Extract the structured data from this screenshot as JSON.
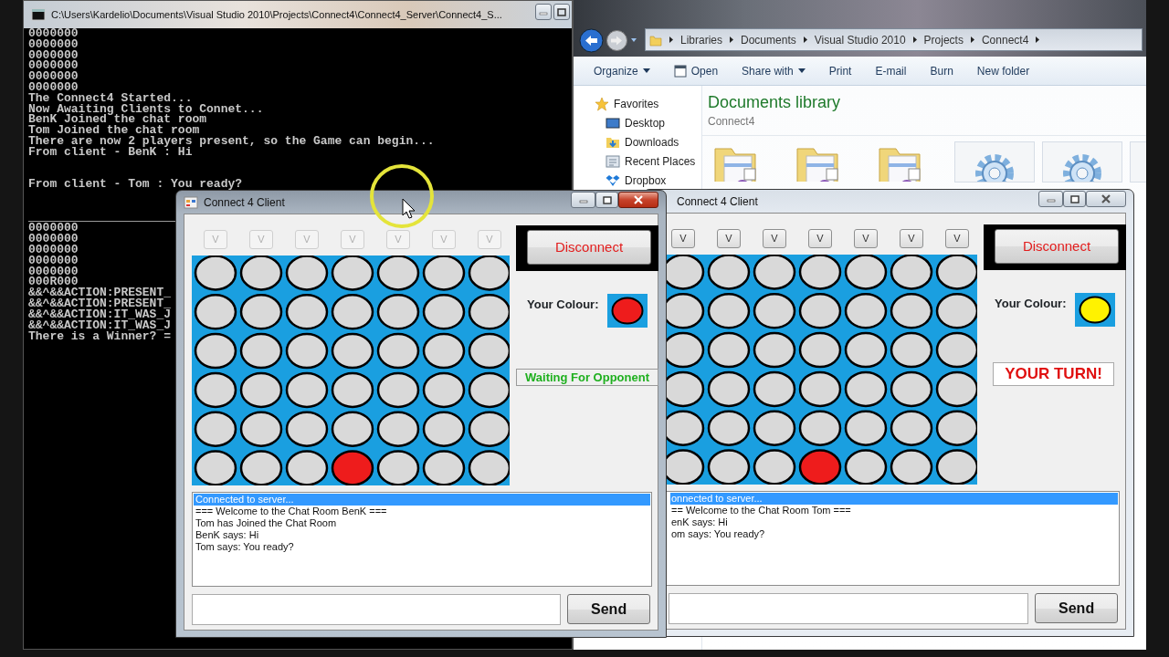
{
  "console": {
    "title": "C:\\Users\\Kardelio\\Documents\\Visual Studio 2010\\Projects\\Connect4\\Connect4_Server\\Connect4_S...",
    "output": [
      "0000000",
      "0000000",
      "0000000",
      "0000000",
      "0000000",
      "0000000",
      "The Connect4 Started...",
      "Now Awaiting Clients to Connet...",
      "BenK Joined the chat room",
      "Tom Joined the chat room",
      "There are now 2 players present, so the Game can begin...",
      "From client - BenK : Hi"
    ],
    "output_after_gap": [
      "From client - Tom : You ready?"
    ],
    "output_lower": [
      "0000000",
      "0000000",
      "0000000",
      "0000000",
      "0000000",
      "000R000",
      "&&^&&ACTION:PRESENT_",
      "&&^&&ACTION:PRESENT_",
      "&&^&&ACTION:IT_WAS_J",
      "&&^&&ACTION:IT_WAS_J",
      "There is a Winner? ="
    ]
  },
  "explorer": {
    "breadcrumb": [
      "Libraries",
      "Documents",
      "Visual Studio 2010",
      "Projects",
      "Connect4"
    ],
    "toolbar": [
      {
        "label": "Organize",
        "kind": "menu"
      },
      {
        "label": "Open",
        "kind": "icon"
      },
      {
        "label": "Share with",
        "kind": "menu"
      },
      {
        "label": "Print",
        "kind": "plain"
      },
      {
        "label": "E-mail",
        "kind": "plain"
      },
      {
        "label": "Burn",
        "kind": "plain"
      },
      {
        "label": "New folder",
        "kind": "plain"
      }
    ],
    "favorites": [
      {
        "label": "Favorites",
        "kind": "star"
      },
      {
        "label": "Desktop",
        "kind": "desktop"
      },
      {
        "label": "Downloads",
        "kind": "downloads"
      },
      {
        "label": "Recent Places",
        "kind": "recent"
      },
      {
        "label": "Dropbox",
        "kind": "dropbox"
      }
    ],
    "library_title": "Documents library",
    "library_subtitle": "Connect4",
    "files": [
      {
        "kind": "folder"
      },
      {
        "kind": "folder"
      },
      {
        "kind": "folder"
      },
      {
        "kind": "program"
      },
      {
        "kind": "program"
      },
      {
        "kind": "program"
      }
    ]
  },
  "clients": [
    {
      "title": "Connect 4 Client",
      "active": true,
      "drop_buttons": [
        {
          "label": "V",
          "disabled": true
        },
        {
          "label": "V",
          "disabled": true
        },
        {
          "label": "V",
          "disabled": true
        },
        {
          "label": "V",
          "disabled": true
        },
        {
          "label": "V",
          "disabled": true
        },
        {
          "label": "V",
          "disabled": true
        },
        {
          "label": "V",
          "disabled": true
        }
      ],
      "board": [
        [
          {
            "filled": false
          },
          {
            "filled": false
          },
          {
            "filled": false
          },
          {
            "filled": false
          },
          {
            "filled": false
          },
          {
            "filled": false
          },
          {
            "filled": false
          }
        ],
        [
          {
            "filled": false
          },
          {
            "filled": false
          },
          {
            "filled": false
          },
          {
            "filled": false
          },
          {
            "filled": false
          },
          {
            "filled": false
          },
          {
            "filled": false
          }
        ],
        [
          {
            "filled": false
          },
          {
            "filled": false
          },
          {
            "filled": false
          },
          {
            "filled": false
          },
          {
            "filled": false
          },
          {
            "filled": false
          },
          {
            "filled": false
          }
        ],
        [
          {
            "filled": false
          },
          {
            "filled": false
          },
          {
            "filled": false
          },
          {
            "filled": false
          },
          {
            "filled": false
          },
          {
            "filled": false
          },
          {
            "filled": false
          }
        ],
        [
          {
            "filled": false
          },
          {
            "filled": false
          },
          {
            "filled": false
          },
          {
            "filled": false
          },
          {
            "filled": false
          },
          {
            "filled": false
          },
          {
            "filled": false
          }
        ],
        [
          {
            "filled": false
          },
          {
            "filled": false
          },
          {
            "filled": false
          },
          {
            "filled": true,
            "color": "#ee1c1c"
          },
          {
            "filled": false
          },
          {
            "filled": false
          },
          {
            "filled": false
          }
        ]
      ],
      "disconnect": "Disconnect",
      "colour_label": "Your Colour:",
      "color": "#ee1c1c",
      "status": {
        "kind": "waiting",
        "text": "Waiting For Opponent"
      },
      "chat": [
        {
          "text": "Connected to server...",
          "selected": true
        },
        {
          "text": "=== Welcome to the Chat Room BenK ===",
          "selected": false
        },
        {
          "text": "Tom has Joined the Chat Room",
          "selected": false
        },
        {
          "text": "BenK says: Hi",
          "selected": false
        },
        {
          "text": "Tom says: You ready?",
          "selected": false
        }
      ],
      "send": "Send"
    },
    {
      "title": "Connect 4 Client",
      "active": false,
      "drop_buttons": [
        {
          "label": "V",
          "disabled": false
        },
        {
          "label": "V",
          "disabled": false
        },
        {
          "label": "V",
          "disabled": false
        },
        {
          "label": "V",
          "disabled": false
        },
        {
          "label": "V",
          "disabled": false
        },
        {
          "label": "V",
          "disabled": false
        },
        {
          "label": "V",
          "disabled": false
        }
      ],
      "board": [
        [
          {
            "filled": false
          },
          {
            "filled": false
          },
          {
            "filled": false
          },
          {
            "filled": false
          },
          {
            "filled": false
          },
          {
            "filled": false
          },
          {
            "filled": false
          }
        ],
        [
          {
            "filled": false
          },
          {
            "filled": false
          },
          {
            "filled": false
          },
          {
            "filled": false
          },
          {
            "filled": false
          },
          {
            "filled": false
          },
          {
            "filled": false
          }
        ],
        [
          {
            "filled": false
          },
          {
            "filled": false
          },
          {
            "filled": false
          },
          {
            "filled": false
          },
          {
            "filled": false
          },
          {
            "filled": false
          },
          {
            "filled": false
          }
        ],
        [
          {
            "filled": false
          },
          {
            "filled": false
          },
          {
            "filled": false
          },
          {
            "filled": false
          },
          {
            "filled": false
          },
          {
            "filled": false
          },
          {
            "filled": false
          }
        ],
        [
          {
            "filled": false
          },
          {
            "filled": false
          },
          {
            "filled": false
          },
          {
            "filled": false
          },
          {
            "filled": false
          },
          {
            "filled": false
          },
          {
            "filled": false
          }
        ],
        [
          {
            "filled": false
          },
          {
            "filled": false
          },
          {
            "filled": false
          },
          {
            "filled": true,
            "color": "#ee1c1c"
          },
          {
            "filled": false
          },
          {
            "filled": false
          },
          {
            "filled": false
          }
        ]
      ],
      "disconnect": "Disconnect",
      "colour_label": "Your Colour:",
      "color": "#fff200",
      "status": {
        "kind": "turn",
        "text": "YOUR TURN!"
      },
      "chat": [
        {
          "text": "onnected to server...",
          "selected": true
        },
        {
          "text": "== Welcome to the Chat Room Tom ===",
          "selected": false
        },
        {
          "text": "enK says: Hi",
          "selected": false
        },
        {
          "text": "om says: You ready?",
          "selected": false
        }
      ],
      "send": "Send"
    }
  ]
}
